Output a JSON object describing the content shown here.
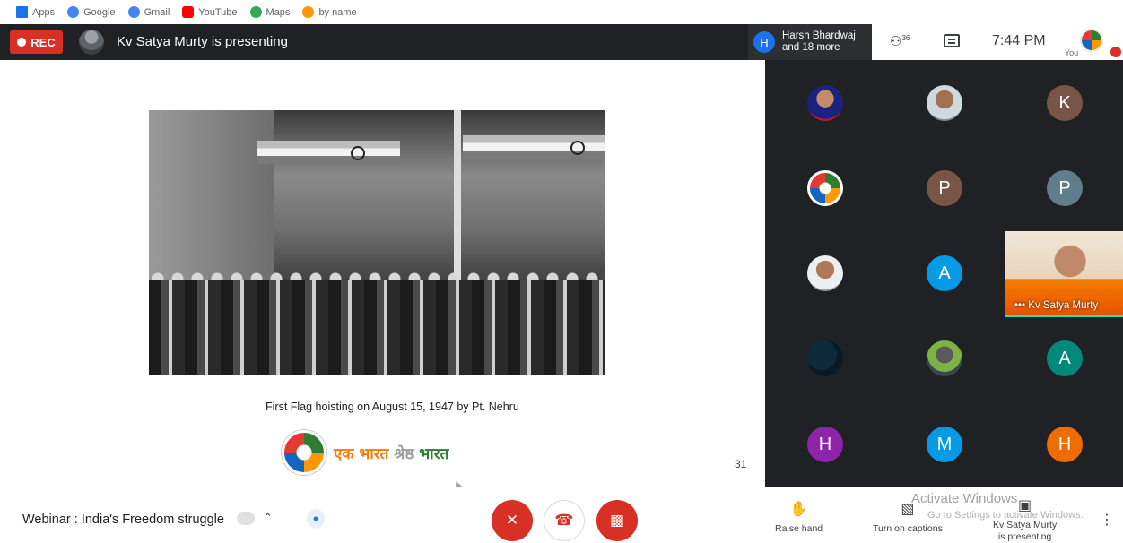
{
  "bookmarks": [
    {
      "label": "Apps",
      "icon": "apps-grid-icon",
      "color": "#1a73e8"
    },
    {
      "label": "Google",
      "icon": "google-icon",
      "color": "#4285f4"
    },
    {
      "label": "Gmail",
      "icon": "google-icon",
      "color": "#4285f4"
    },
    {
      "label": "YouTube",
      "icon": "youtube-icon",
      "color": "#ff0000"
    },
    {
      "label": "Maps",
      "icon": "maps-icon",
      "color": "#34a853"
    },
    {
      "label": "by name",
      "icon": "site-icon",
      "color": "#ff9800"
    }
  ],
  "topbar": {
    "rec_label": "REC",
    "presenting_title": "Kv Satya Murty is presenting",
    "people_chip": {
      "avatar_letter": "H",
      "line1": "Harsh Bhardwaj",
      "line2": "and 18 more"
    },
    "participant_count": "36",
    "time": "7:44 PM",
    "you_label": "You"
  },
  "slide": {
    "caption": "First Flag hoisting on August 15, 1947 by Pt. Nehru",
    "tagline_word1": "एक भारत",
    "tagline_word2": "श्रेष्ठ",
    "tagline_word3": "भारत",
    "slide_number": "31"
  },
  "participants": [
    {
      "letter": "",
      "kind": "photo",
      "style": "ph1"
    },
    {
      "letter": "",
      "kind": "photo",
      "style": "ph2"
    },
    {
      "letter": "K",
      "kind": "letter",
      "color": "#795548"
    },
    {
      "letter": "",
      "kind": "photo",
      "style": "ph3"
    },
    {
      "letter": "P",
      "kind": "letter",
      "color": "#795548"
    },
    {
      "letter": "P",
      "kind": "letter",
      "color": "#607d8b"
    },
    {
      "letter": "",
      "kind": "photo",
      "style": "ph4"
    },
    {
      "letter": "A",
      "kind": "letter",
      "color": "#039be5"
    },
    {
      "letter": "",
      "kind": "photo",
      "style": "ph5"
    },
    {
      "letter": "",
      "kind": "photo",
      "style": "ph6"
    },
    {
      "letter": "A",
      "kind": "letter",
      "color": "#00897b"
    },
    {
      "letter": "H",
      "kind": "letter",
      "color": "#8e24aa"
    },
    {
      "letter": "M",
      "kind": "letter",
      "color": "#039be5"
    },
    {
      "letter": "H",
      "kind": "letter",
      "color": "#ef6c00"
    }
  ],
  "video_tile": {
    "name": "Kv Satya Murty"
  },
  "bottombar": {
    "meeting_title": "Webinar : India's Freedom struggle",
    "raise_hand_label": "Raise hand",
    "captions_label": "Turn on captions",
    "present_label_line1": "Kv Satya Murty",
    "present_label_line2": "is presenting",
    "watermark_title": "Activate Windows",
    "watermark_sub": "Go to Settings to activate Windows."
  }
}
